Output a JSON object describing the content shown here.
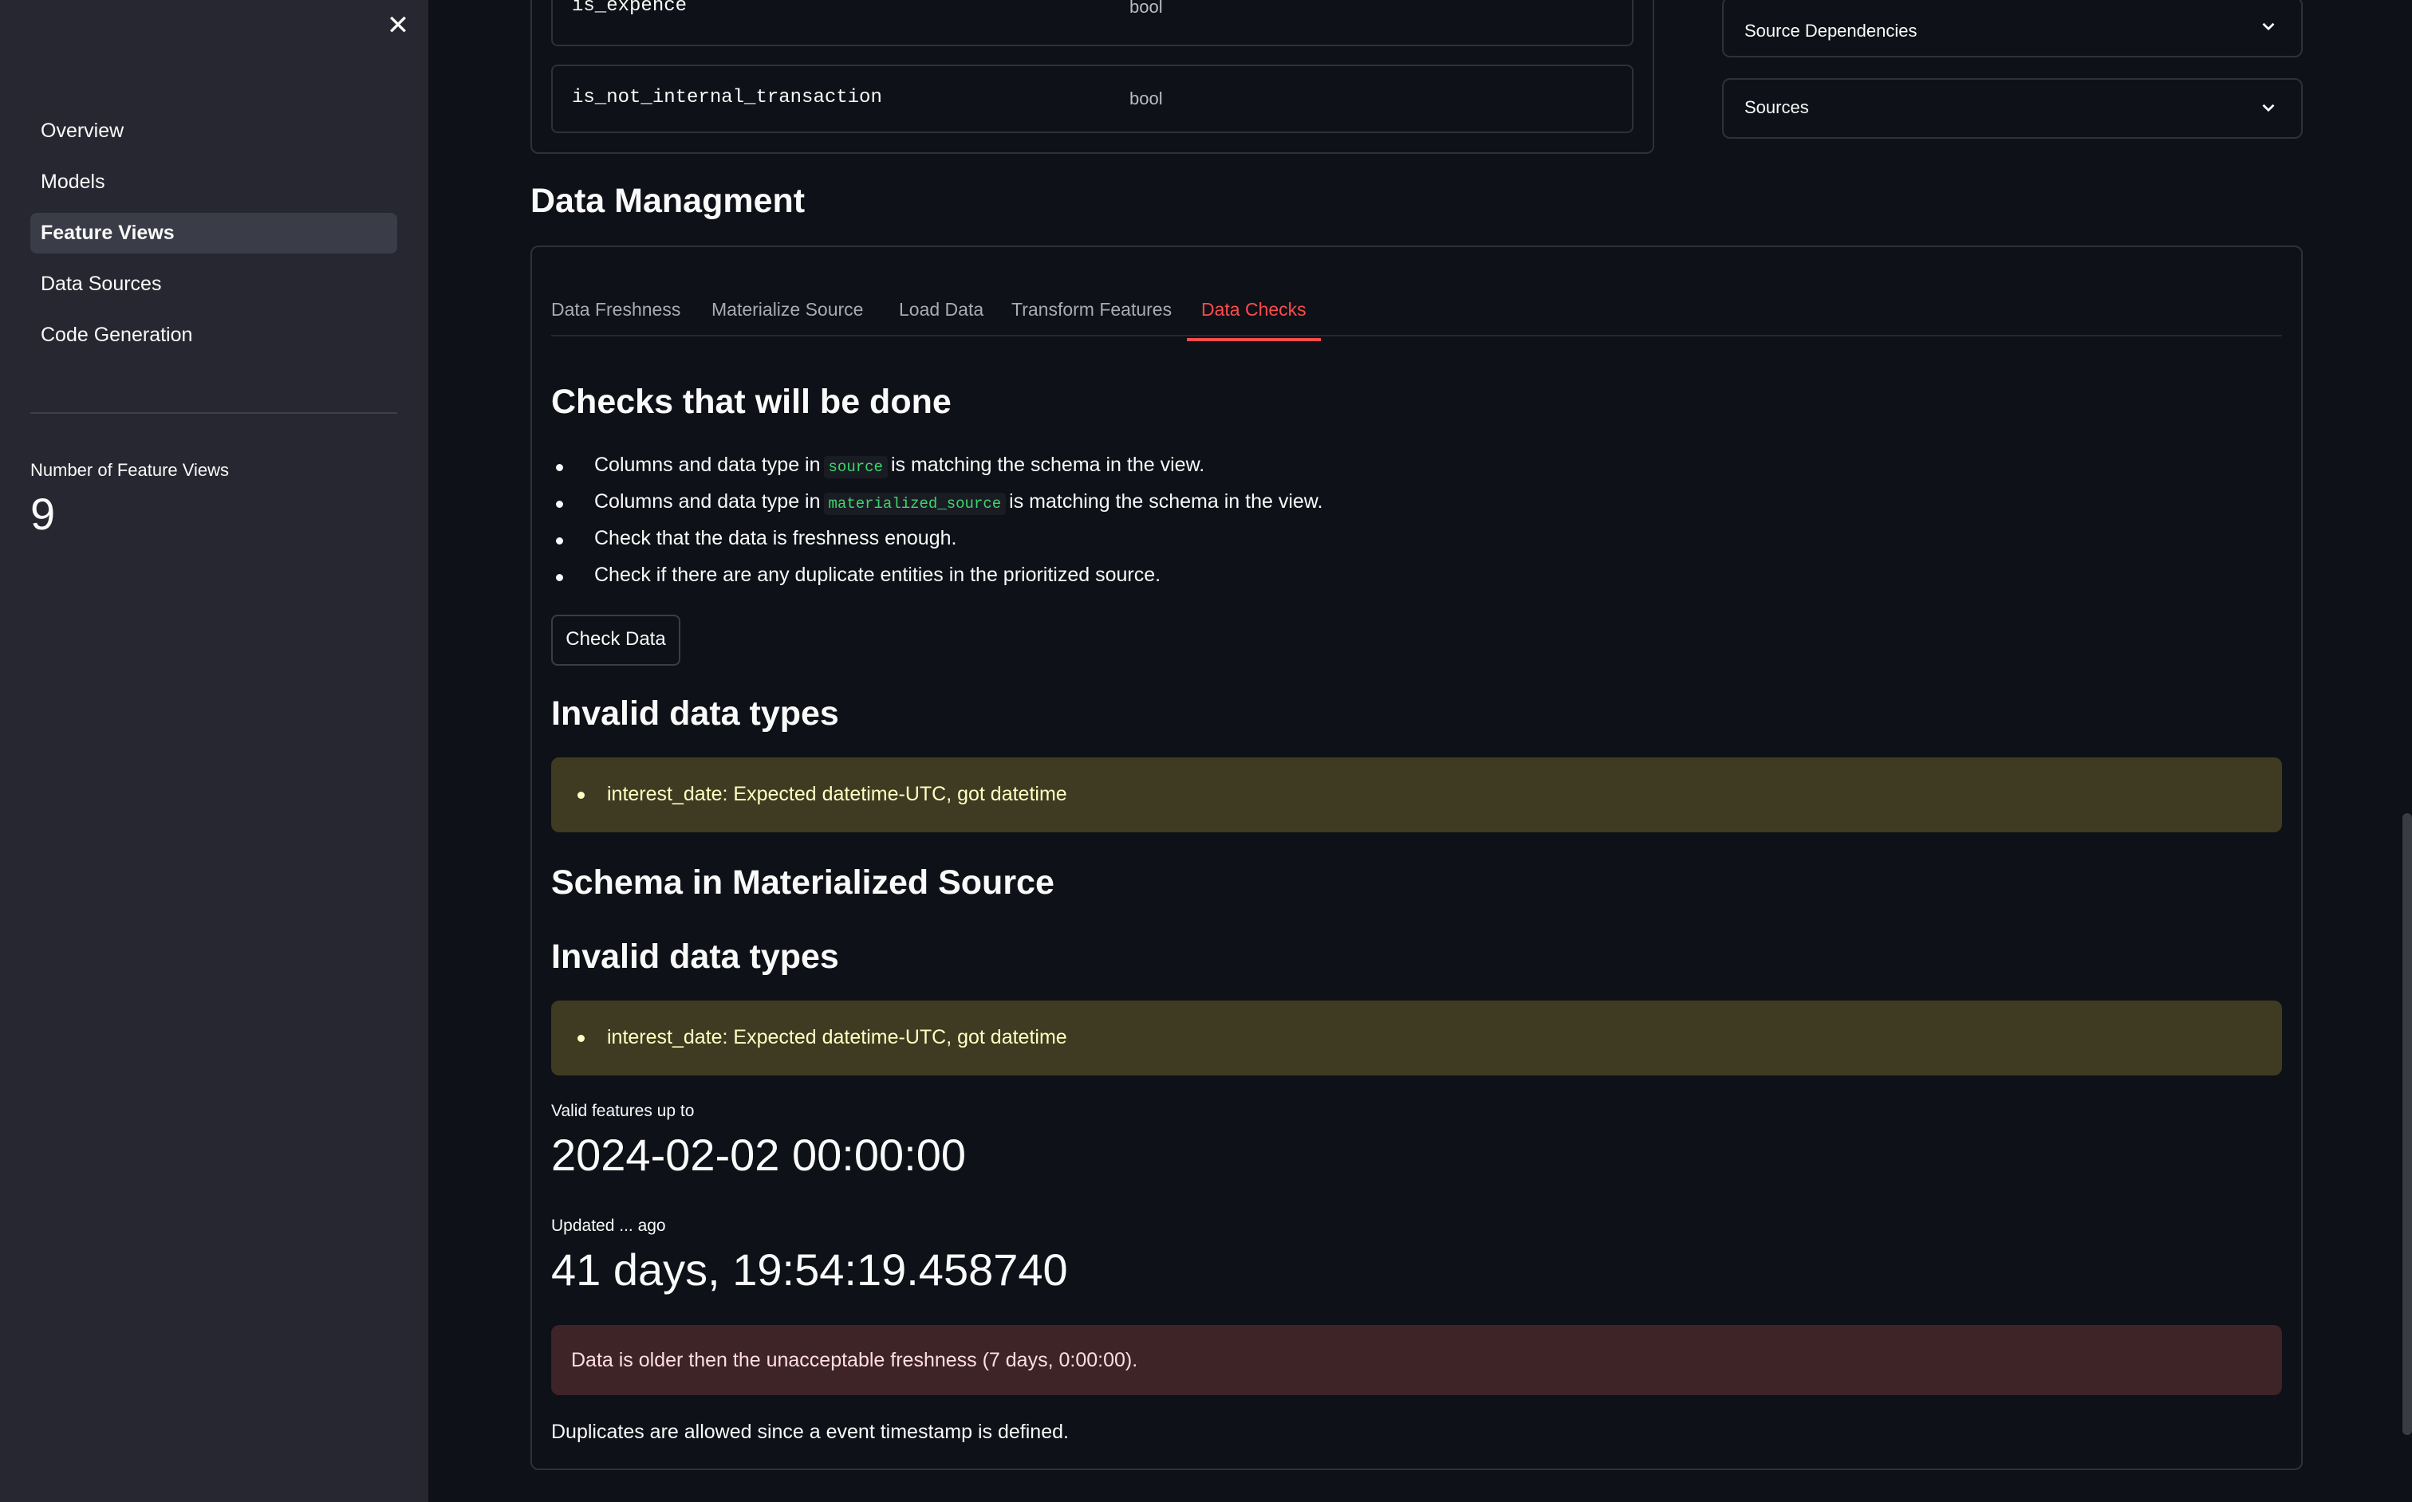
{
  "sidebar": {
    "close_icon": "close-icon",
    "nav": [
      {
        "label": "Overview",
        "active": false
      },
      {
        "label": "Models",
        "active": false
      },
      {
        "label": "Feature Views",
        "active": true
      },
      {
        "label": "Data Sources",
        "active": false
      },
      {
        "label": "Code Generation",
        "active": false
      }
    ],
    "metric": {
      "label": "Number of Feature Views",
      "value": "9"
    }
  },
  "schema": {
    "rows": [
      {
        "name": "is_expence",
        "type": "bool"
      },
      {
        "name": "is_not_internal_transaction",
        "type": "bool"
      }
    ]
  },
  "expanders": [
    {
      "label": "Source Dependencies",
      "icon": "chevron-down-icon"
    },
    {
      "label": "Sources",
      "icon": "chevron-down-icon"
    }
  ],
  "data_management": {
    "title": "Data Managment",
    "tabs": [
      {
        "label": "Data Freshness"
      },
      {
        "label": "Materialize Source"
      },
      {
        "label": "Load Data"
      },
      {
        "label": "Transform Features"
      },
      {
        "label": "Data Checks",
        "active": true
      }
    ],
    "checks_heading": "Checks that will be done",
    "checks": [
      {
        "pre": "Columns and data type in",
        "code": "source",
        "post": "is matching the schema in the view."
      },
      {
        "pre": "Columns and data type in",
        "code": "materialized_source",
        "post": "is matching the schema in the view."
      },
      {
        "pre": "Check that the data is freshness enough.",
        "code": "",
        "post": ""
      },
      {
        "pre": "Check if there are any duplicate entities in the prioritized source.",
        "code": "",
        "post": ""
      }
    ],
    "check_button": "Check Data",
    "invalid_heading_1": "Invalid data types",
    "invalid_msg_1": "interest_date: Expected datetime-UTC, got datetime",
    "schema_materialized_heading": "Schema in Materialized Source",
    "invalid_heading_2": "Invalid data types",
    "invalid_msg_2": "interest_date: Expected datetime-UTC, got datetime",
    "valid_features_label": "Valid features up to",
    "valid_features_value": "2024-02-02 00:00:00",
    "updated_label": "Updated ... ago",
    "updated_value": "41 days, 19:54:19.458740",
    "error_msg": "Data is older then the unacceptable freshness (7 days, 0:00:00).",
    "duplicates_msg": "Duplicates are allowed since a event timestamp is defined."
  }
}
